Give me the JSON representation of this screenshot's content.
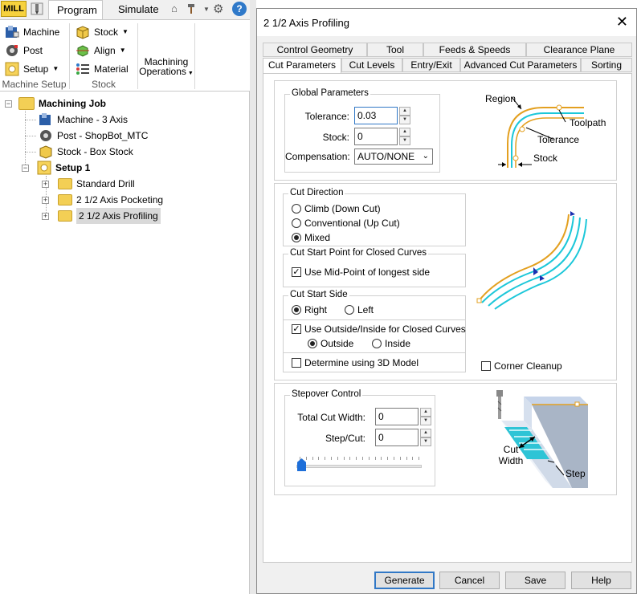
{
  "app": {
    "badge": "MILL",
    "tabs": [
      "Program",
      "Simulate"
    ],
    "active_tab": "Program"
  },
  "ribbon": {
    "groups": [
      {
        "label": "Machine Setup",
        "buttons": [
          "Machine",
          "Post",
          "Setup"
        ]
      },
      {
        "label": "Stock",
        "buttons": [
          "Stock",
          "Align",
          "Material"
        ]
      },
      {
        "label": "",
        "buttons": [
          "Machining Operations"
        ]
      }
    ],
    "machining_ops_line1": "Machining",
    "machining_ops_line2": "Operations"
  },
  "tree": {
    "root": "Machining Job",
    "machine": "Machine - 3 Axis",
    "post": "Post - ShopBot_MTC",
    "stock": "Stock - Box Stock",
    "setup": "Setup 1",
    "ops": [
      "Standard Drill",
      "2 1/2 Axis Pocketing",
      "2 1/2 Axis Profiling"
    ],
    "selected": "2 1/2 Axis Profiling"
  },
  "dialog": {
    "title": "2 1/2 Axis Profiling",
    "tabs_row1": [
      "Control Geometry",
      "Tool",
      "Feeds & Speeds",
      "Clearance Plane"
    ],
    "tabs_row2": [
      "Cut Parameters",
      "Cut Levels",
      "Entry/Exit",
      "Advanced Cut Parameters",
      "Sorting"
    ],
    "active_tab": "Cut Parameters",
    "global": {
      "label": "Global Parameters",
      "tolerance_label": "Tolerance:",
      "tolerance_value": "0.03",
      "stock_label": "Stock:",
      "stock_value": "0",
      "compensation_label": "Compensation:",
      "compensation_value": "AUTO/NONE"
    },
    "diagram1": {
      "region": "Region",
      "toolpath": "Toolpath",
      "tolerance": "Tolerance",
      "stock": "Stock"
    },
    "cut_direction": {
      "label": "Cut Direction",
      "options": [
        "Climb (Down Cut)",
        "Conventional (Up Cut)",
        "Mixed"
      ],
      "selected": "Mixed"
    },
    "cut_start_point": {
      "label": "Cut Start Point for Closed Curves",
      "mid_point": "Use Mid-Point of longest side",
      "mid_point_checked": true
    },
    "cut_start_side": {
      "label": "Cut Start Side",
      "right": "Right",
      "left": "Left",
      "selected": "Right",
      "use_outside_inside": "Use Outside/Inside for Closed Curves",
      "use_outside_inside_checked": true,
      "outside": "Outside",
      "inside": "Inside",
      "outside_inside_selected": "Outside",
      "determine_3d": "Determine using 3D Model",
      "determine_3d_checked": false
    },
    "corner_cleanup": "Corner Cleanup",
    "corner_cleanup_checked": false,
    "stepover": {
      "label": "Stepover Control",
      "total_cut_width_label": "Total Cut Width:",
      "total_cut_width_value": "0",
      "step_cut_label": "Step/Cut:",
      "step_cut_value": "0",
      "slider_value": 0
    },
    "diagram3": {
      "cut_width_line1": "Cut",
      "cut_width_line2": "Width",
      "step": "Step"
    },
    "buttons": [
      "Generate",
      "Cancel",
      "Save",
      "Help"
    ]
  }
}
